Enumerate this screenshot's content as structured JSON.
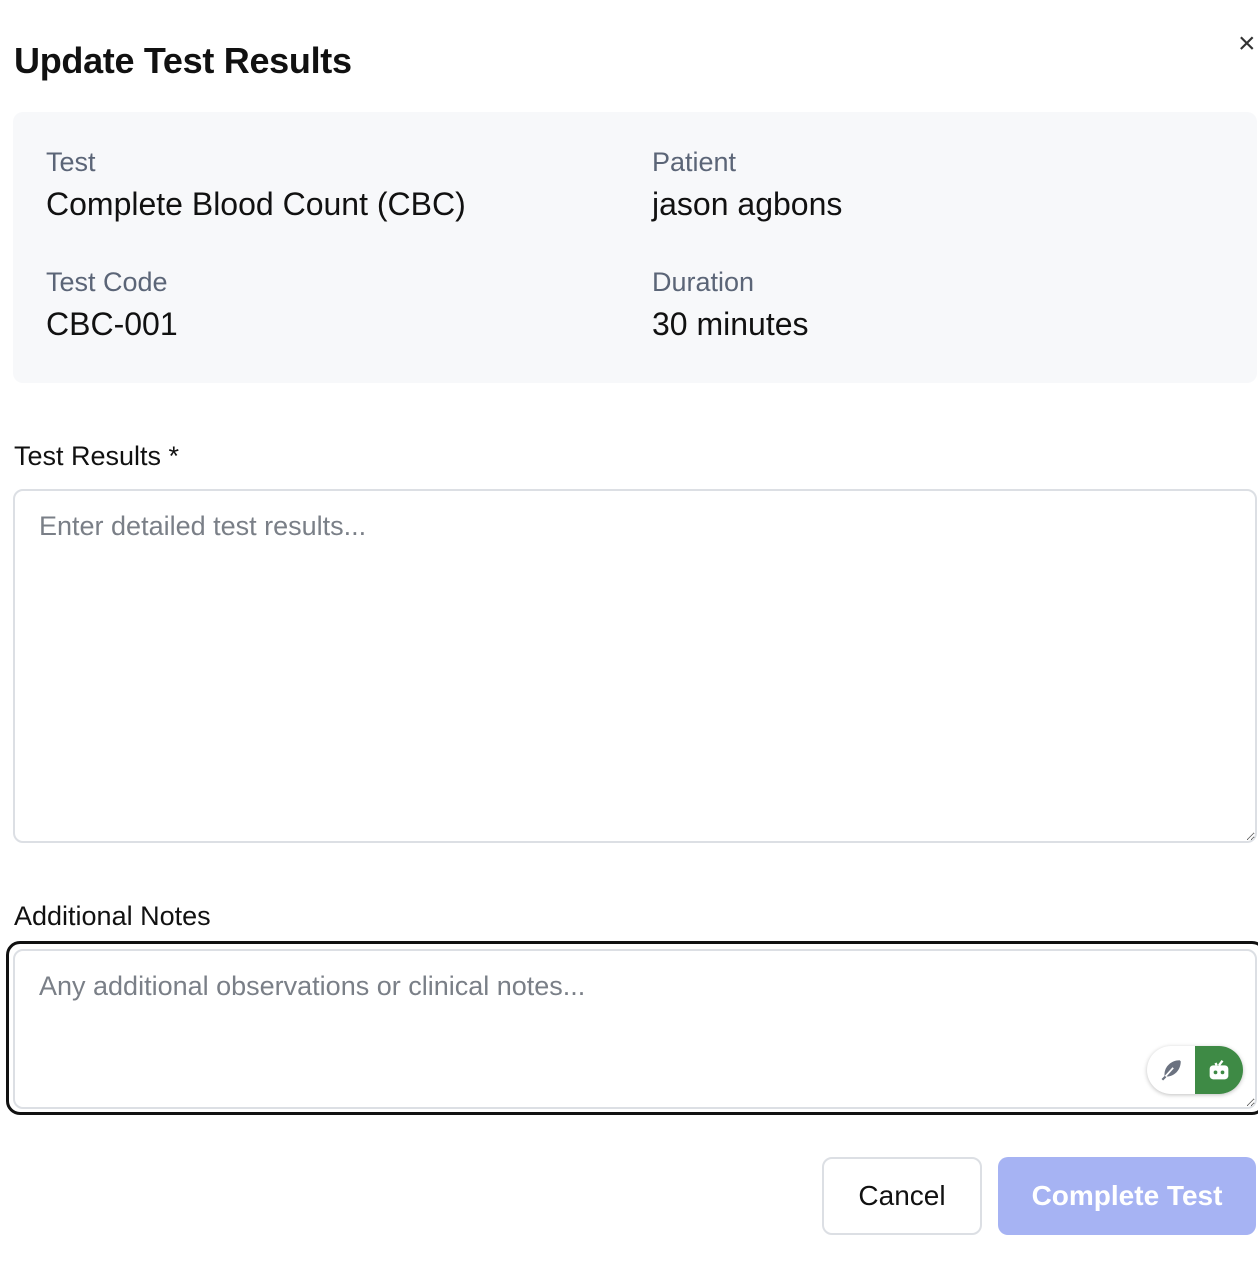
{
  "dialog": {
    "title": "Update Test Results",
    "close_icon": "close-icon"
  },
  "info": {
    "test_label": "Test",
    "test_value": "Complete Blood Count (CBC)",
    "patient_label": "Patient",
    "patient_value": "jason agbons",
    "code_label": "Test Code",
    "code_value": "CBC-001",
    "duration_label": "Duration",
    "duration_value": "30 minutes"
  },
  "form": {
    "results_label": "Test Results *",
    "results_placeholder": "Enter detailed test results...",
    "results_value": "",
    "notes_label": "Additional Notes",
    "notes_placeholder": "Any additional observations or clinical notes...",
    "notes_value": ""
  },
  "assist": {
    "left_icon": "feather-icon",
    "right_icon": "robot-icon",
    "accent": "#3e8a45"
  },
  "actions": {
    "cancel_label": "Cancel",
    "complete_label": "Complete Test",
    "complete_color": "#a6b3f3"
  }
}
